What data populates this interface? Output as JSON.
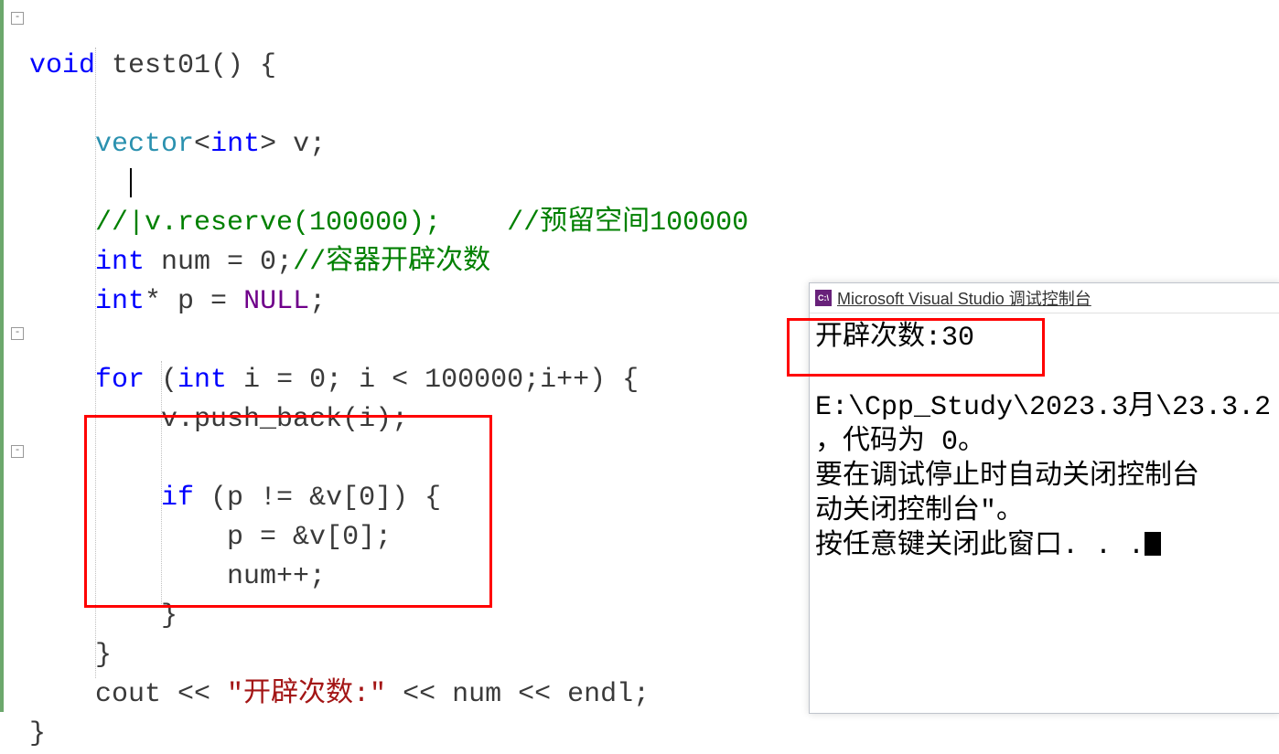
{
  "code": {
    "l1_void": "void",
    "l1_name": " test01() {",
    "l3_vec": "vector",
    "l3_open": "<",
    "l3_int": "int",
    "l3_rest": "> v;",
    "l5_comment": "//|v.reserve(100000);    //预留空间100000",
    "l6_int": "int",
    "l6_rest": " num = 0;",
    "l6_comment": "//容器开辟次数",
    "l7_int": "int",
    "l7_rest": "* p = ",
    "l7_null": "NULL",
    "l7_semi": ";",
    "l9_for": "for",
    "l9_open": " (",
    "l9_int": "int",
    "l9_rest": " i = 0; i < 100000;i++) {",
    "l10": "v.push_back(i);",
    "l12_if": "if",
    "l12_rest": " (p != &v[0]) {",
    "l13": "p = &v[0];",
    "l14": "num++;",
    "l15": "}",
    "l16": "}",
    "l17_cout": "cout << ",
    "l17_str": "\"开辟次数:\"",
    "l17_rest": " << num << endl;",
    "l18": "}"
  },
  "console": {
    "title": "Microsoft Visual Studio 调试控制台",
    "line1": "开辟次数:30",
    "line3": "E:\\Cpp_Study\\2023.3月\\23.3.2",
    "line4": "，代码为 0。",
    "line5": "要在调试停止时自动关闭控制台",
    "line6": "动关闭控制台\"。",
    "line7": "按任意键关闭此窗口. . ."
  }
}
